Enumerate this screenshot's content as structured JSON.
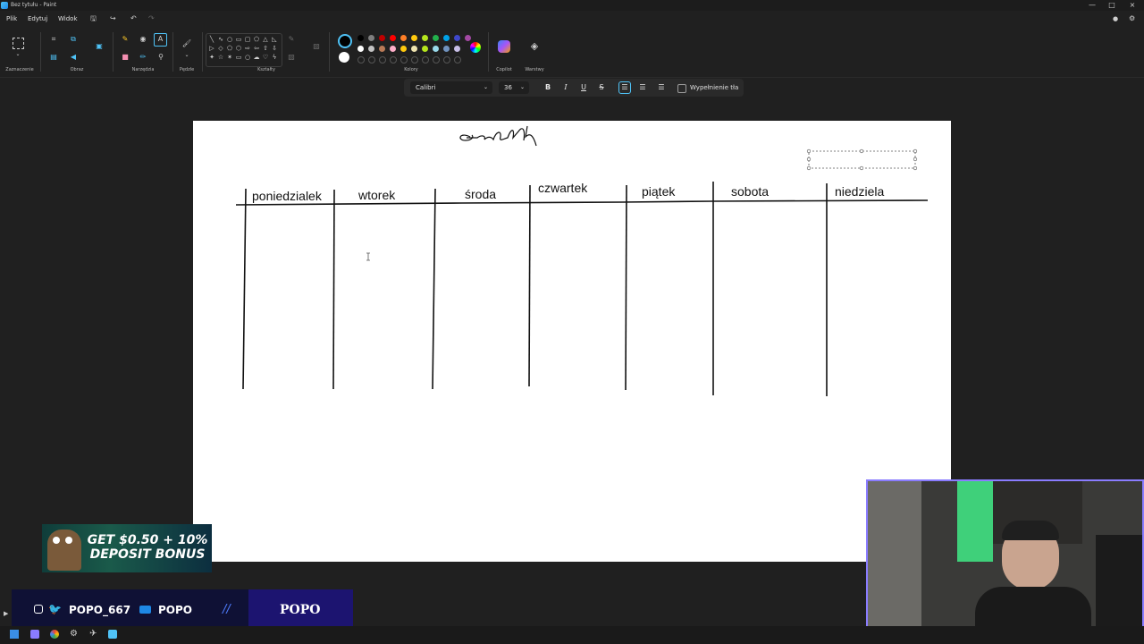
{
  "window": {
    "title": "Bez tytułu - Paint",
    "controls": [
      "—",
      "□",
      "×"
    ]
  },
  "menu": {
    "items": [
      "Plik",
      "Edytuj",
      "Widok"
    ]
  },
  "ribbon": {
    "groups": [
      "Zaznaczenie",
      "Obraz",
      "Narzędzia",
      "Pędzle",
      "Kształty",
      "Kolory",
      "Copilot",
      "Warstwy"
    ],
    "palette_colors": [
      "#000000",
      "#7f7f7f",
      "#c00000",
      "#ff0000",
      "#ff7f27",
      "#ffc90e",
      "#b5e61d",
      "#22b14c",
      "#00a2e8",
      "#3f48cc",
      "#a349a4",
      "#ffffff",
      "#c3c3c3",
      "#b97a57",
      "#ffaec9",
      "#ffc90e",
      "#efe4b0",
      "#b5e61d",
      "#99d9ea",
      "#7092be",
      "#c8bfe7"
    ]
  },
  "text_toolbar": {
    "font": "Calibri",
    "size": "36",
    "bold": "B",
    "italic": "I",
    "underline": "U",
    "strike": "S",
    "fill_label": "Wypełnienie tła"
  },
  "canvas": {
    "heading_scribble": "Grafik",
    "days": [
      "poniedzialek",
      "wtorek",
      "środa",
      "czwartek",
      "piątek",
      "sobota",
      "niedziela"
    ]
  },
  "promo": {
    "text": "GET $0.50 + 10% DEPOSIT BONUS"
  },
  "social": {
    "twitter_handle": "POPO_667",
    "youtube_name": "POPO",
    "brand": "POPO"
  }
}
